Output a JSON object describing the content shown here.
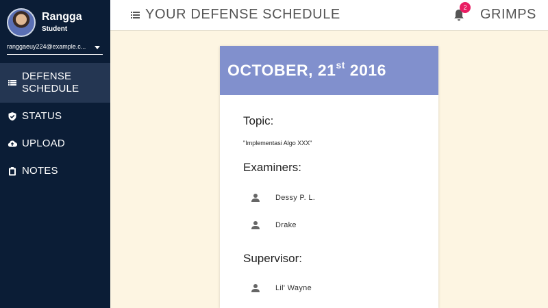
{
  "user": {
    "name": "Rangga",
    "role": "Student",
    "email": "ranggaeuy224@example.c..."
  },
  "nav": {
    "items": [
      {
        "label": "DEFENSE SCHEDULE",
        "icon": "list-icon",
        "active": true
      },
      {
        "label": "STATUS",
        "icon": "shield-check-icon"
      },
      {
        "label": "UPLOAD",
        "icon": "cloud-upload-icon"
      },
      {
        "label": "NOTES",
        "icon": "clipboard-icon"
      }
    ]
  },
  "header": {
    "title": "YOUR DEFENSE SCHEDULE",
    "notification_count": "2",
    "brand": "GRIMPS"
  },
  "schedule": {
    "date_prefix": "OCTOBER, 21",
    "date_suffix": "st",
    "date_year": " 2016",
    "topic_label": "Topic:",
    "topic_value": "\"Implementasi Algo XXX\"",
    "examiners_label": "Examiners:",
    "examiners": [
      "Dessy P. L.",
      "Drake"
    ],
    "supervisor_label": "Supervisor:",
    "supervisors": [
      "Lil' Wayne"
    ]
  },
  "colors": {
    "sidebar_bg": "#0b1d36",
    "sidebar_active_bg": "#243652",
    "card_header_bg": "#8190cd",
    "page_bg": "#fdf5e2",
    "badge_bg": "#e91e63"
  }
}
